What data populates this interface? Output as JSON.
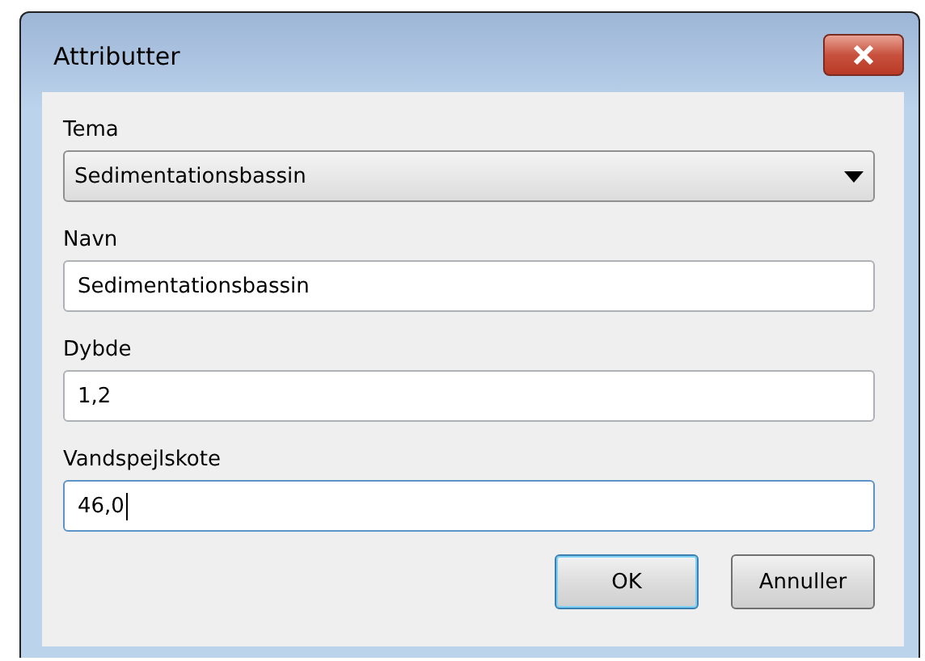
{
  "window": {
    "title": "Attributter"
  },
  "fields": [
    {
      "label": "Tema",
      "kind": "dropdown",
      "value": "Sedimentationsbassin",
      "focused": false
    },
    {
      "label": "Navn",
      "kind": "text",
      "value": "Sedimentationsbassin",
      "focused": false
    },
    {
      "label": "Dybde",
      "kind": "text",
      "value": "1,2",
      "focused": false
    },
    {
      "label": "Vandspejlskote",
      "kind": "text",
      "value": "46,0",
      "focused": true
    }
  ],
  "buttons": [
    {
      "label": "OK",
      "default": true
    },
    {
      "label": "Annuller",
      "default": false
    }
  ]
}
